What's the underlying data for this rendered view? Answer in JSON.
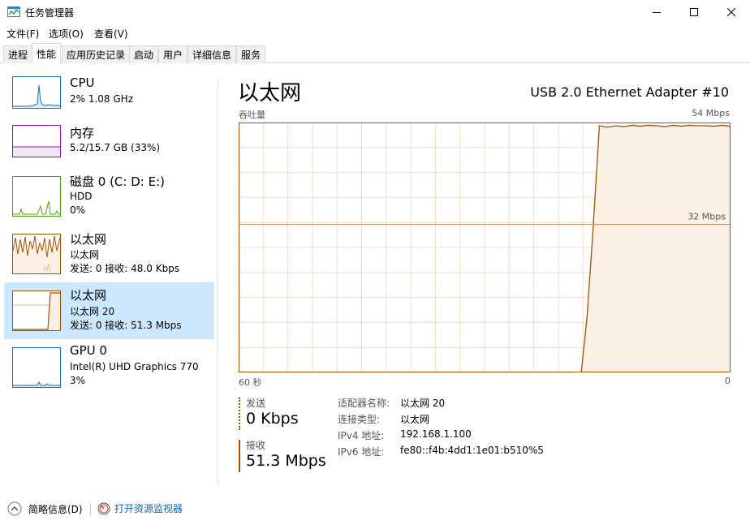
{
  "window": {
    "title": "任务管理器",
    "controls": [
      "minimize",
      "maximize",
      "close"
    ]
  },
  "menu": {
    "items": [
      "文件(F)",
      "选项(O)",
      "查看(V)"
    ]
  },
  "tabs": [
    {
      "label": "进程",
      "active": false
    },
    {
      "label": "性能",
      "active": true
    },
    {
      "label": "应用历史记录",
      "active": false
    },
    {
      "label": "启动",
      "active": false
    },
    {
      "label": "用户",
      "active": false
    },
    {
      "label": "详细信息",
      "active": false
    },
    {
      "label": "服务",
      "active": false
    }
  ],
  "sidebar": {
    "items": [
      {
        "name": "CPU",
        "line1": "2% 1.08 GHz",
        "line2": "",
        "color": "#1171b9",
        "selected": false
      },
      {
        "name": "内存",
        "line1": "5.2/15.7 GB (33%)",
        "line2": "",
        "color": "#8b13a3",
        "selected": false
      },
      {
        "name": "磁盘 0 (C: D: E:)",
        "line1": "HDD",
        "line2": "0%",
        "color": "#4da60c",
        "selected": false
      },
      {
        "name": "以太网",
        "line1": "以太网",
        "line2": "发送: 0 接收: 48.0 Kbps",
        "color": "#a74f01",
        "selected": false
      },
      {
        "name": "以太网",
        "line1": "以太网 20",
        "line2": "发送: 0 接收: 51.3 Mbps",
        "color": "#a74f01",
        "selected": true
      },
      {
        "name": "GPU 0",
        "line1": "Intel(R) UHD Graphics 770",
        "line2": "3%",
        "color": "#1171b9",
        "selected": false
      }
    ]
  },
  "main": {
    "title": "以太网",
    "adapter": "USB 2.0 Ethernet Adapter #10",
    "graph_label": "吞吐量",
    "max_label": "54 Mbps",
    "mid_label": "32 Mbps",
    "time_left": "60 秒",
    "time_right": "0",
    "accent": "#a74f01",
    "fill": "#fcefe3"
  },
  "chart_data": {
    "type": "area",
    "title": "",
    "ylabel": "吞吐量",
    "ylim": [
      0,
      54
    ],
    "xlim": [
      60,
      0
    ],
    "reference_line": 32,
    "x": [
      60,
      56,
      52,
      48,
      44,
      40,
      36,
      32,
      28,
      24,
      20,
      18.2,
      17.5,
      16.8,
      16,
      15,
      14,
      13,
      12,
      11,
      10,
      9,
      8,
      7,
      6,
      5,
      4,
      3,
      2,
      1,
      0
    ],
    "values": [
      0,
      0,
      0,
      0,
      0,
      0,
      0,
      0,
      0,
      0,
      0,
      0,
      12,
      30,
      53.3,
      53.0,
      53.3,
      53.1,
      53.4,
      53.2,
      53.4,
      53.3,
      53.1,
      53.4,
      53.2,
      53.4,
      53.3,
      53.3,
      53.2,
      53.4,
      53.2
    ]
  },
  "stats": {
    "send_label": "发送",
    "send_value": "0 Kbps",
    "recv_label": "接收",
    "recv_value": "51.3 Mbps"
  },
  "info": [
    {
      "key": "适配器名称:",
      "value": "以太网 20"
    },
    {
      "key": "连接类型:",
      "value": "以太网"
    },
    {
      "key": "IPv4 地址:",
      "value": "192.168.1.100"
    },
    {
      "key": "IPv6 地址:",
      "value": "fe80::f4b:4dd1:1e01:b510%5"
    }
  ],
  "footer": {
    "summary": "简略信息(D)",
    "open_monitor": "打开资源监视器"
  }
}
